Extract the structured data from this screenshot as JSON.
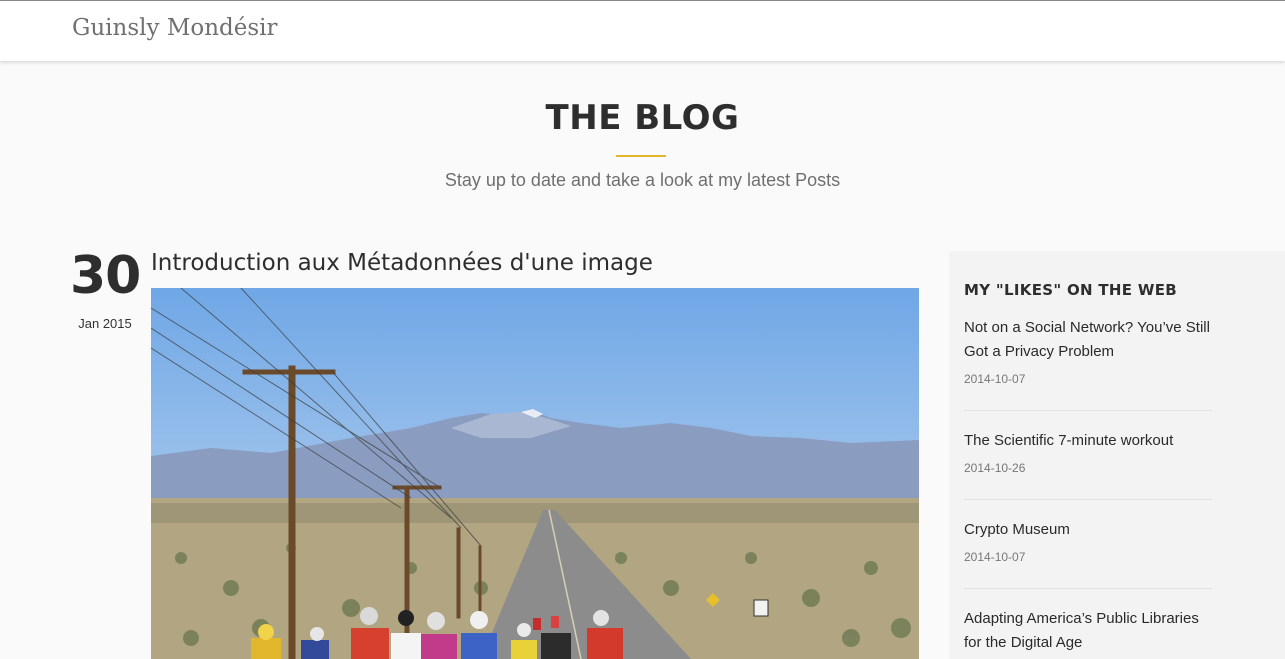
{
  "navbar": {
    "brand": "Guinsly Mondésir"
  },
  "hero": {
    "title": "THE BLOG",
    "subtitle": "Stay up to date and take a look at my latest Posts",
    "accent_color": "#e4b52a"
  },
  "post": {
    "day": "30",
    "month_year": "Jan 2015",
    "title": "Introduction aux Métadonnées d'une image",
    "image_description": "photo"
  },
  "sidebar": {
    "title": "MY \"LIKES\" ON THE WEB",
    "items": [
      {
        "title": "Not on a Social Network? You’ve Still Got a Privacy Problem",
        "date": "2014-10-07"
      },
      {
        "title": "The Scientific 7-minute workout",
        "date": "2014-10-26"
      },
      {
        "title": "Crypto Museum",
        "date": "2014-10-07"
      },
      {
        "title": "Adapting America’s Public Libraries for the Digital Age",
        "date": ""
      }
    ]
  }
}
